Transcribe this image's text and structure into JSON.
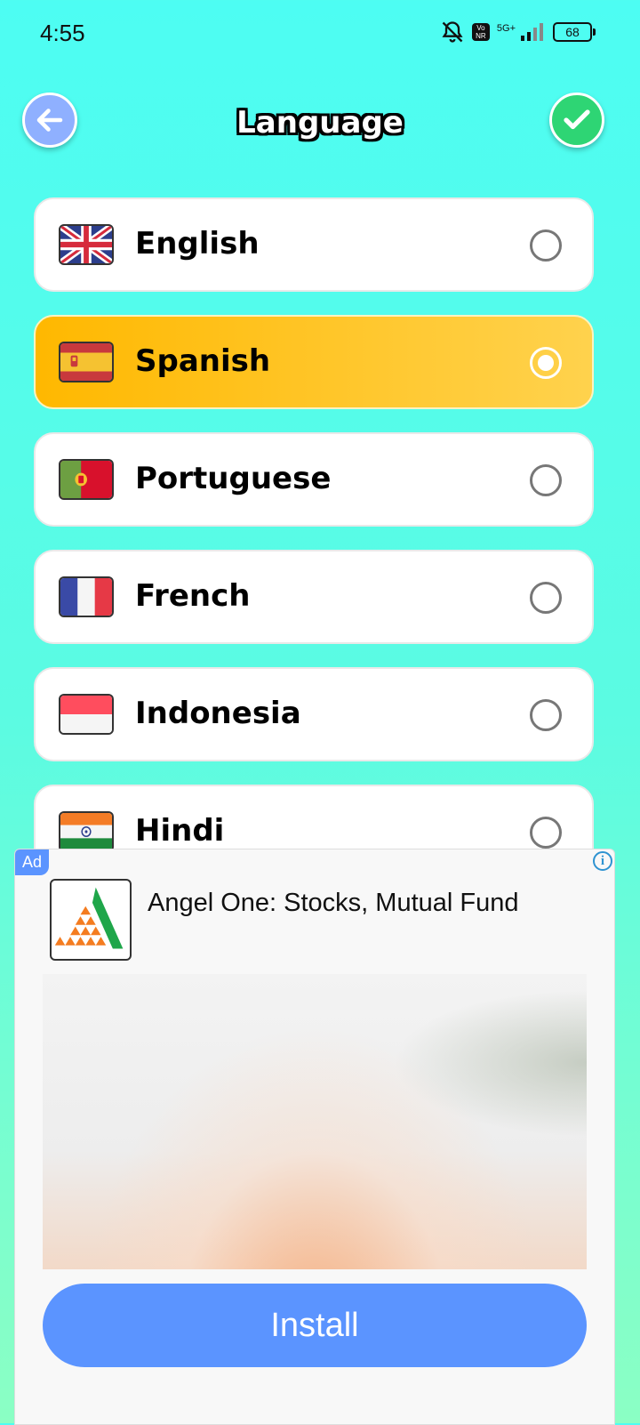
{
  "status_bar": {
    "time": "4:55",
    "network": "5G+",
    "volte": "Vo NR",
    "battery": "68"
  },
  "header": {
    "title": "Language",
    "back_icon": "arrow-left-icon",
    "confirm_icon": "checkmark-icon"
  },
  "languages": [
    {
      "label": "English",
      "flag": "uk-flag",
      "selected": false
    },
    {
      "label": "Spanish",
      "flag": "spain-flag",
      "selected": true
    },
    {
      "label": "Portuguese",
      "flag": "portugal-flag",
      "selected": false
    },
    {
      "label": "French",
      "flag": "france-flag",
      "selected": false
    },
    {
      "label": "Indonesia",
      "flag": "indonesia-flag",
      "selected": false
    },
    {
      "label": "Hindi",
      "flag": "india-flag",
      "selected": false
    }
  ],
  "ad": {
    "badge": "Ad",
    "info": "i",
    "title": "Angel One: Stocks, Mutual Fund",
    "install_label": "Install"
  },
  "colors": {
    "background_top": "#4dfdf3",
    "selected_item": "#ffc21f",
    "install_button": "#5b94ff",
    "confirm_button": "#2ed574",
    "back_button": "#8fb0ff"
  }
}
